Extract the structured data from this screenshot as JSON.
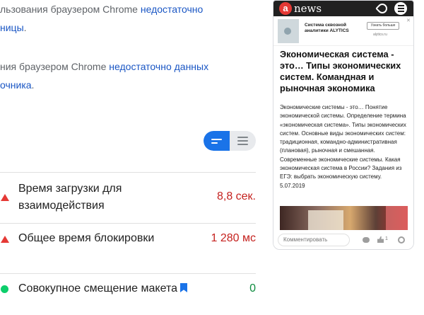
{
  "notes": [
    {
      "line1_text": "льзования браузером Chrome ",
      "line1_link": "недостаточно",
      "line2_link": "ницы",
      "line2_tail": "."
    },
    {
      "line1_text": "ния браузером Chrome ",
      "line1_link": "недостаточно данных",
      "line2_link": "очника",
      "line2_tail": "."
    }
  ],
  "view_toggle": {
    "active": "list-compact",
    "options": [
      "list-compact",
      "list-expanded"
    ]
  },
  "metrics": [
    {
      "name_line1": "Время загрузки для",
      "name_line2": "взаимодействия",
      "value": "8,8 сек.",
      "status": "bad"
    },
    {
      "name_line1": "Общее время блокировки",
      "value": "1 280 мс",
      "status": "bad"
    },
    {
      "name_line1": "Совокупное смещение макета",
      "value": "0",
      "status": "good"
    }
  ],
  "status_colors": {
    "bad": "#e53935",
    "good": "#0cce6b",
    "accent": "#1a73e8"
  },
  "phone": {
    "logo_letter": "a",
    "logo_text": "news",
    "ad": {
      "title": "Система сквозной аналитики ALYTICS",
      "button": "Узнать больше",
      "site": "alytics.ru",
      "close": "✕"
    },
    "article_title": "Экономическая система - это… Типы экономических систем. Командная и рыночная экономика",
    "article_body": "Экономические системы - это… Понятие экономической системы. Определение термина «экономическая система». Типы экономических систем. Основные виды экономических систем: традиционная, командно-административная (плановая), рыночная и смешанная. Современные экономические системы. Какая экономическая система в России? Задания из ЕГЭ: выбрать экономическую систему.",
    "article_date": "5.07.2019",
    "comment_placeholder": "Комментировать",
    "like_count": "1"
  }
}
